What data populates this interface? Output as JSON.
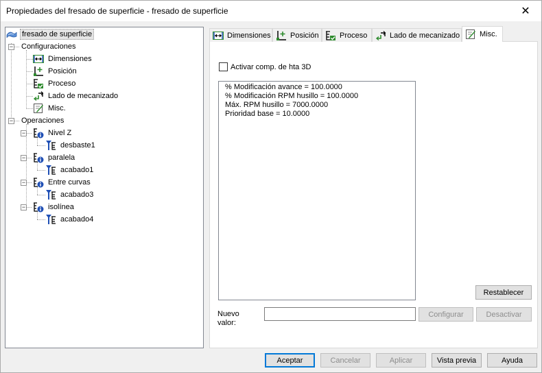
{
  "window": {
    "title": "Propiedades del fresado de superficie - fresado de superficie",
    "close_glyph": "✕"
  },
  "tree": {
    "root": "fresado de superficie",
    "configuraciones": "Configuraciones",
    "config_items": [
      "Dimensiones",
      "Posición",
      "Proceso",
      "Lado de mecanizado",
      "Misc."
    ],
    "operaciones": "Operaciones",
    "operations": [
      {
        "name": "Nivel Z",
        "child": "desbaste1"
      },
      {
        "name": "paralela",
        "child": "acabado1"
      },
      {
        "name": "Entre curvas",
        "child": "acabado3"
      },
      {
        "name": "isolínea",
        "child": "acabado4"
      }
    ],
    "expanded_glyph": "−"
  },
  "tabs": [
    {
      "label": "Dimensiones",
      "icon": "dimensions-icon"
    },
    {
      "label": "Posición",
      "icon": "position-icon"
    },
    {
      "label": "Proceso",
      "icon": "process-icon"
    },
    {
      "label": "Lado de mecanizado",
      "icon": "machining-side-icon"
    },
    {
      "label": "Misc.",
      "icon": "misc-icon",
      "active": true
    }
  ],
  "misc": {
    "checkbox_label": "Activar comp. de hta 3D",
    "checkbox_checked": false,
    "params": [
      "% Modificación avance = 100.0000",
      "% Modificación RPM husillo = 100.0000",
      "Máx. RPM husillo = 7000.0000",
      "Prioridad base = 10.0000"
    ],
    "reset_label": "Restablecer",
    "new_value_label": "Nuevo\nvalor:",
    "new_value": "",
    "configure_label": "Configurar",
    "deactivate_label": "Desactivar"
  },
  "footer": {
    "accept": "Aceptar",
    "cancel": "Cancelar",
    "apply": "Aplicar",
    "preview": "Vista previa",
    "help": "Ayuda"
  },
  "colors": {
    "accent": "#0078d7",
    "icon_green": "#2e8b2e",
    "icon_blue": "#1f4fb5",
    "selection": "#e5e5e5"
  }
}
